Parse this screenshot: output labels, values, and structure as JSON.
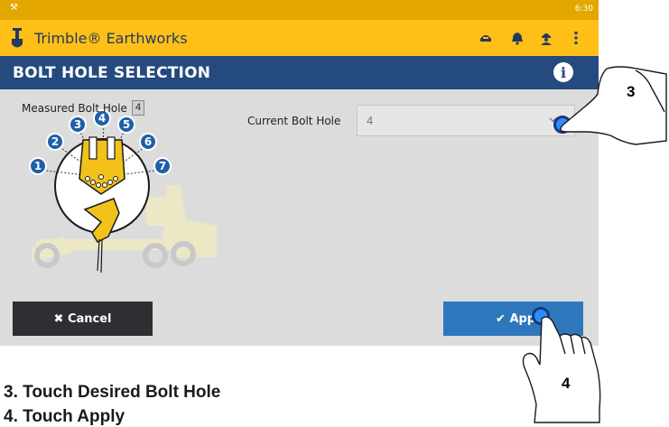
{
  "status_bar": {
    "time": "6:30",
    "icon": "wrench-icon"
  },
  "app_bar": {
    "title": "Trimble® Earthworks",
    "icons": [
      "shovel-logo-icon",
      "machine-icon",
      "bell-icon",
      "operator-icon",
      "more-vert-icon"
    ]
  },
  "page": {
    "title": "BOLT HOLE SELECTION",
    "info_icon": "info-icon"
  },
  "diagram": {
    "measured_label": "Measured Bolt Hole",
    "measured_value": "4",
    "hole_numbers": [
      "1",
      "2",
      "3",
      "4",
      "5",
      "6",
      "7"
    ]
  },
  "selection": {
    "label": "Current Bolt Hole",
    "value": "4"
  },
  "buttons": {
    "cancel_label": "Cancel",
    "apply_label": "Apply"
  },
  "callouts": [
    "3",
    "4"
  ],
  "instructions": [
    "3. Touch Desired Bolt Hole",
    "4. Touch Apply"
  ],
  "colors": {
    "status_bar": "#e3a700",
    "app_bar": "#ffbf18",
    "title_bar": "#254a7e",
    "cancel_button": "#2e2e33",
    "apply_button": "#2f77bd",
    "hole_badge": "#1f5fa8"
  }
}
